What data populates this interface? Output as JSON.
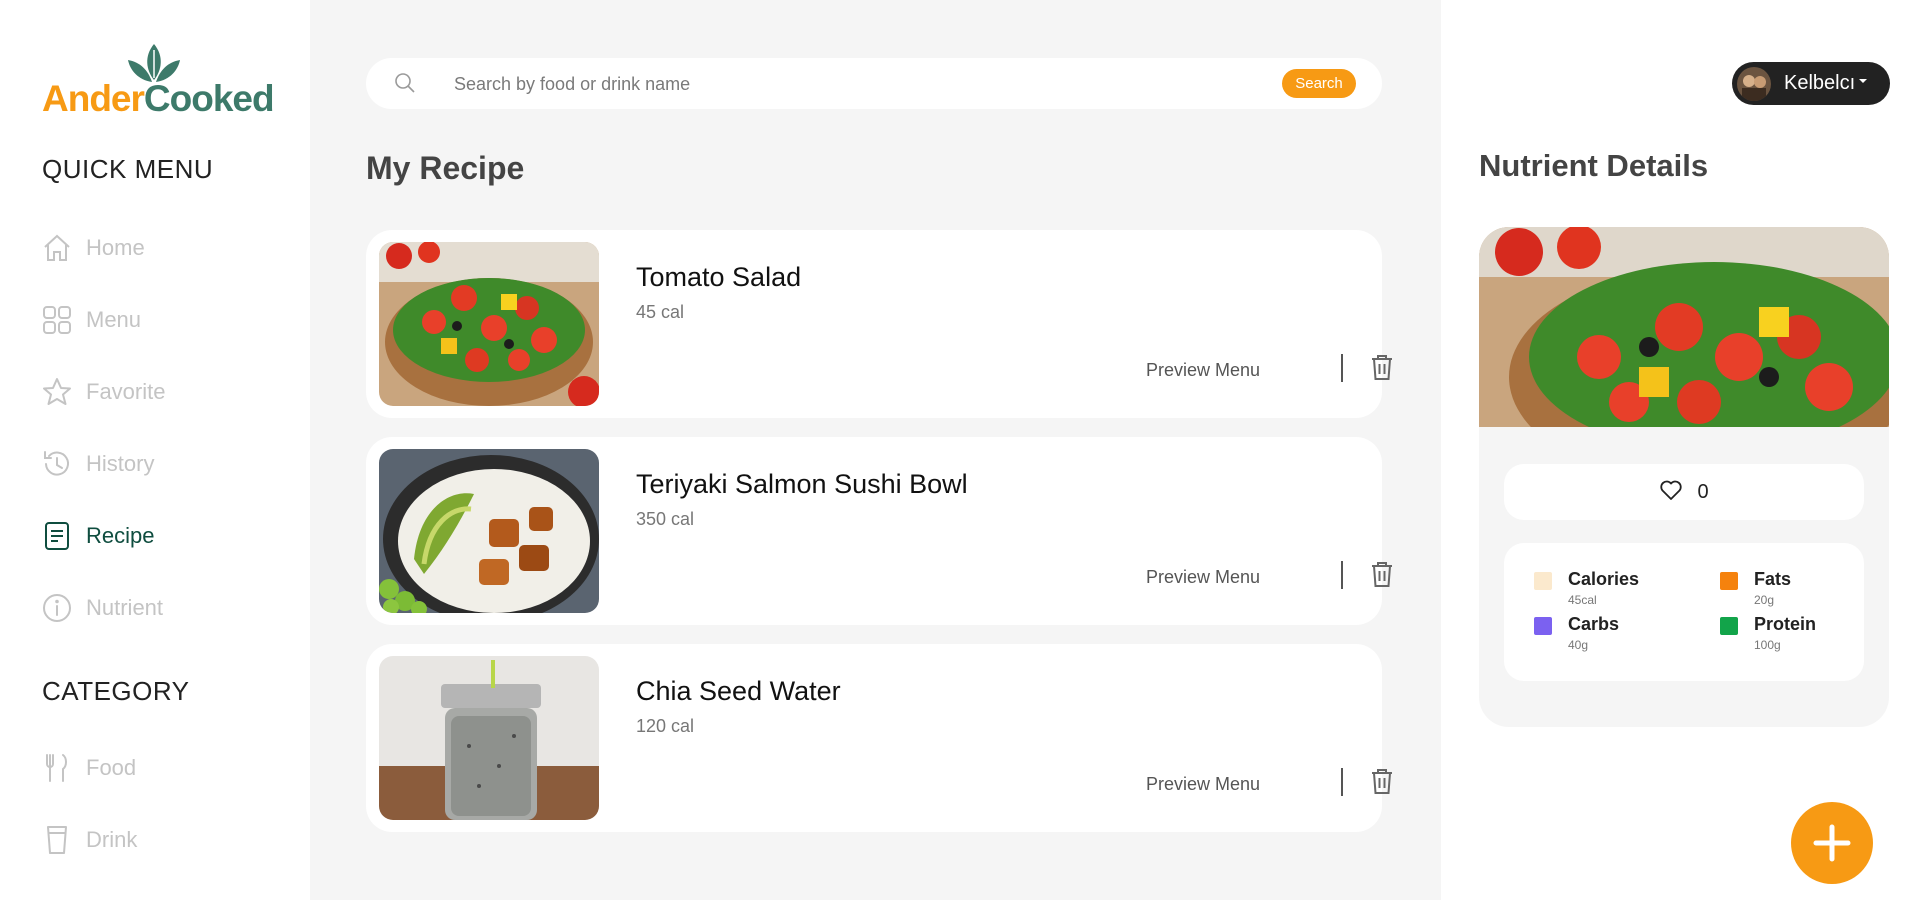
{
  "brand": {
    "part1": "Ander",
    "part2": "Cooked"
  },
  "sidebar": {
    "quick_menu_title": "QUICK MENU",
    "category_title": "CATEGORY",
    "items": [
      {
        "label": "Home",
        "icon": "home-icon"
      },
      {
        "label": "Menu",
        "icon": "grid-icon"
      },
      {
        "label": "Favorite",
        "icon": "star-icon"
      },
      {
        "label": "History",
        "icon": "history-icon"
      },
      {
        "label": "Recipe",
        "icon": "recipe-icon",
        "active": true
      },
      {
        "label": "Nutrient",
        "icon": "info-icon"
      }
    ],
    "categories": [
      {
        "label": "Food",
        "icon": "utensils-icon"
      },
      {
        "label": "Drink",
        "icon": "cup-icon"
      }
    ]
  },
  "search": {
    "placeholder": "Search by food or drink name",
    "button": "Search"
  },
  "main": {
    "title": "My Recipe",
    "recipes": [
      {
        "name": "Tomato Salad",
        "calories": "45 cal",
        "preview": "Preview Menu"
      },
      {
        "name": "Teriyaki Salmon Sushi Bowl",
        "calories": "350 cal",
        "preview": "Preview Menu"
      },
      {
        "name": "Chia Seed Water",
        "calories": "120 cal",
        "preview": "Preview Menu"
      }
    ]
  },
  "user": {
    "name": "Kelbelcı"
  },
  "nutrient": {
    "title": "Nutrient Details",
    "likes": "0",
    "legend": [
      {
        "name": "Calories",
        "value": "45cal",
        "color": "#fbe9cd"
      },
      {
        "name": "Fats",
        "value": "20g",
        "color": "#f5820d"
      },
      {
        "name": "Carbs",
        "value": "40g",
        "color": "#7b61f0"
      },
      {
        "name": "Protein",
        "value": "100g",
        "color": "#12a44a"
      }
    ]
  },
  "colors": {
    "accent": "#f79a14",
    "brand_green": "#3d7a6a",
    "active_nav": "#0f4d3f"
  }
}
